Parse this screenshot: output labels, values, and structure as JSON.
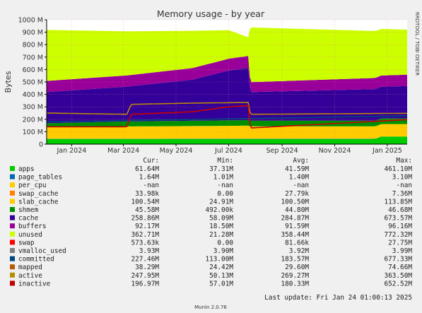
{
  "chart_data": {
    "type": "area",
    "title": "Memory usage - by year",
    "ylabel": "Bytes",
    "side_label": "RRDTOOL / TOBI OETIKER",
    "ylim": [
      0,
      1000
    ],
    "y_unit": "M",
    "y_ticks": [
      "0",
      "100 M",
      "200 M",
      "300 M",
      "400 M",
      "500 M",
      "600 M",
      "700 M",
      "800 M",
      "900 M",
      "1000 M"
    ],
    "x_ticks": [
      "Jan 2024",
      "Mar 2024",
      "May 2024",
      "Jul 2024",
      "Sep 2024",
      "Nov 2024",
      "Jan 2025"
    ],
    "x_start": "2023-12-03",
    "x_end": "2025-01-24",
    "grid": true,
    "stacked_series_approx_M": [
      {
        "name": "apps",
        "color": "#00CC00",
        "values": [
          {
            "x": "2023-12-03",
            "y": 42
          },
          {
            "x": "2024-12-18",
            "y": 42
          },
          {
            "x": "2024-12-25",
            "y": 60
          },
          {
            "x": "2025-01-24",
            "y": 60
          }
        ]
      },
      {
        "name": "page_tables",
        "color": "#0066B3",
        "values": [
          {
            "x": "2023-12-03",
            "y": 1.4
          },
          {
            "x": "2025-01-24",
            "y": 1.6
          }
        ]
      },
      {
        "name": "swap_cache",
        "color": "#FF8000",
        "values": [
          {
            "x": "2023-12-03",
            "y": 0
          },
          {
            "x": "2025-01-24",
            "y": 0
          }
        ]
      },
      {
        "name": "slab_cache",
        "color": "#FFCC00",
        "values": [
          {
            "x": "2023-12-03",
            "y": 95
          },
          {
            "x": "2024-07-24",
            "y": 105
          },
          {
            "x": "2024-07-26",
            "y": 100
          },
          {
            "x": "2025-01-24",
            "y": 100
          }
        ]
      },
      {
        "name": "shmem",
        "color": "#008F00",
        "values": [
          {
            "x": "2023-12-03",
            "y": 30
          },
          {
            "x": "2024-03-05",
            "y": 40
          },
          {
            "x": "2024-07-26",
            "y": 45
          },
          {
            "x": "2025-01-24",
            "y": 45
          }
        ]
      },
      {
        "name": "cache",
        "color": "#330099",
        "values": [
          {
            "x": "2023-12-03",
            "y": 250
          },
          {
            "x": "2024-03-05",
            "y": 280
          },
          {
            "x": "2024-05-20",
            "y": 330
          },
          {
            "x": "2024-07-01",
            "y": 400
          },
          {
            "x": "2024-07-24",
            "y": 420
          },
          {
            "x": "2024-07-26",
            "y": 230
          },
          {
            "x": "2025-01-24",
            "y": 260
          }
        ]
      },
      {
        "name": "buffers",
        "color": "#990099",
        "values": [
          {
            "x": "2023-12-03",
            "y": 90
          },
          {
            "x": "2024-03-05",
            "y": 90
          },
          {
            "x": "2024-07-24",
            "y": 96
          },
          {
            "x": "2024-07-26",
            "y": 80
          },
          {
            "x": "2025-01-24",
            "y": 92
          }
        ]
      },
      {
        "name": "unused",
        "color": "#CCFF00",
        "values": [
          {
            "x": "2023-12-03",
            "y": 410
          },
          {
            "x": "2024-03-05",
            "y": 355
          },
          {
            "x": "2024-05-20",
            "y": 300
          },
          {
            "x": "2024-07-01",
            "y": 230
          },
          {
            "x": "2024-07-24",
            "y": 150
          },
          {
            "x": "2024-07-26",
            "y": 440
          },
          {
            "x": "2025-01-24",
            "y": 362
          }
        ]
      }
    ],
    "line_series_approx_M": [
      {
        "name": "committed",
        "color": "#00487D",
        "values": [
          {
            "x": "2023-12-03",
            "y": 180
          },
          {
            "x": "2025-01-24",
            "y": 227
          }
        ]
      },
      {
        "name": "active",
        "color": "#B8860B",
        "values": [
          {
            "x": "2023-12-03",
            "y": 250
          },
          {
            "x": "2024-03-05",
            "y": 240
          },
          {
            "x": "2024-03-10",
            "y": 320
          },
          {
            "x": "2024-05-20",
            "y": 330
          },
          {
            "x": "2024-07-24",
            "y": 335
          },
          {
            "x": "2024-07-26",
            "y": 240
          },
          {
            "x": "2025-01-24",
            "y": 248
          }
        ]
      },
      {
        "name": "inactive",
        "color": "#CC0000",
        "values": [
          {
            "x": "2023-12-03",
            "y": 140
          },
          {
            "x": "2024-03-05",
            "y": 140
          },
          {
            "x": "2024-03-10",
            "y": 240
          },
          {
            "x": "2024-05-20",
            "y": 260
          },
          {
            "x": "2024-07-01",
            "y": 300
          },
          {
            "x": "2024-07-24",
            "y": 310
          },
          {
            "x": "2024-07-26",
            "y": 130
          },
          {
            "x": "2025-01-24",
            "y": 197
          }
        ]
      }
    ],
    "legend": {
      "headers": {
        "cur": "Cur:",
        "min": "Min:",
        "avg": "Avg:",
        "max": "Max:"
      },
      "rows": [
        {
          "name": "apps",
          "color": "#00CC00",
          "cur": "61.64M",
          "min": "37.31M",
          "avg": "41.59M",
          "max": "461.10M"
        },
        {
          "name": "page_tables",
          "color": "#0066B3",
          "cur": "1.64M",
          "min": "1.01M",
          "avg": "1.40M",
          "max": "3.10M"
        },
        {
          "name": "per_cpu",
          "color": "#FFCC00",
          "cur": "-nan",
          "min": "-nan",
          "avg": "-nan",
          "max": "-nan"
        },
        {
          "name": "swap_cache",
          "color": "#FF8000",
          "cur": "33.98k",
          "min": "0.00",
          "avg": "27.79k",
          "max": "7.36M"
        },
        {
          "name": "slab_cache",
          "color": "#FFCC00",
          "cur": "100.54M",
          "min": "24.91M",
          "avg": "100.50M",
          "max": "113.85M"
        },
        {
          "name": "shmem",
          "color": "#008F00",
          "cur": "45.58M",
          "min": "492.00k",
          "avg": "44.80M",
          "max": "46.68M"
        },
        {
          "name": "cache",
          "color": "#330099",
          "cur": "258.86M",
          "min": "58.09M",
          "avg": "284.87M",
          "max": "673.57M"
        },
        {
          "name": "buffers",
          "color": "#990099",
          "cur": "92.17M",
          "min": "18.50M",
          "avg": "91.59M",
          "max": "96.16M"
        },
        {
          "name": "unused",
          "color": "#CCFF00",
          "cur": "362.71M",
          "min": "21.28M",
          "avg": "358.44M",
          "max": "772.32M"
        },
        {
          "name": "swap",
          "color": "#FF0000",
          "cur": "573.63k",
          "min": "0.00",
          "avg": "81.66k",
          "max": "27.75M"
        },
        {
          "name": "vmalloc_used",
          "color": "#808080",
          "cur": "3.93M",
          "min": "3.90M",
          "avg": "3.92M",
          "max": "3.99M"
        },
        {
          "name": "committed",
          "color": "#00487D",
          "cur": "227.46M",
          "min": "113.00M",
          "avg": "183.57M",
          "max": "677.33M"
        },
        {
          "name": "mapped",
          "color": "#B35A00",
          "cur": "38.29M",
          "min": "24.42M",
          "avg": "29.60M",
          "max": "74.66M"
        },
        {
          "name": "active",
          "color": "#B38F00",
          "cur": "247.95M",
          "min": "50.13M",
          "avg": "269.27M",
          "max": "363.50M"
        },
        {
          "name": "inactive",
          "color": "#BE0000",
          "cur": "196.97M",
          "min": "57.01M",
          "avg": "180.33M",
          "max": "652.52M"
        }
      ]
    },
    "last_update": "Last update: Fri Jan 24 01:00:13 2025",
    "footer": "Munin 2.0.76"
  }
}
